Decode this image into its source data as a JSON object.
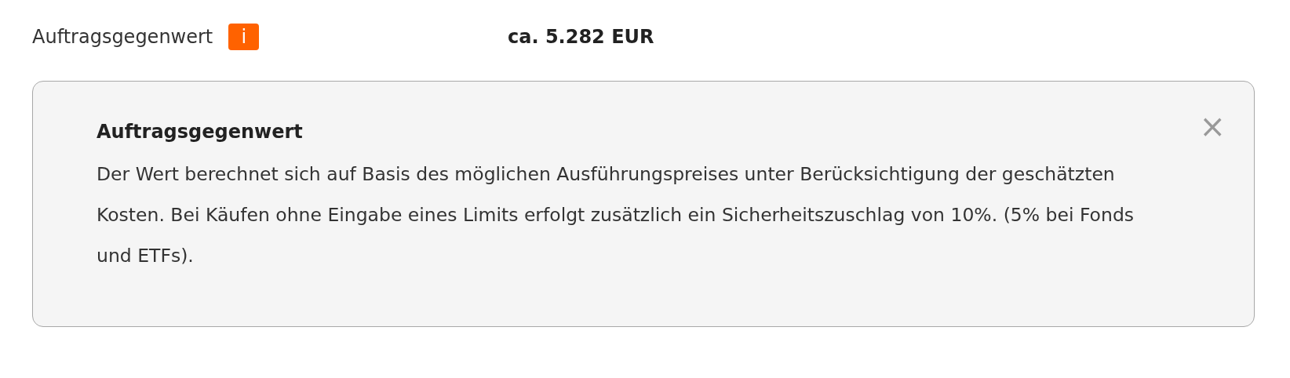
{
  "field": {
    "label": "Auftragsgegenwert",
    "info_button": "i",
    "value": "ca. 5.282 EUR"
  },
  "info_panel": {
    "title": "Auftragsgegenwert",
    "text": "Der Wert berechnet sich auf Basis des möglichen Ausführungspreises unter Berücksichtigung der geschätzten Kosten. Bei Käufen ohne Eingabe eines Limits erfolgt zusätzlich ein Sicherheitszuschlag von 10%. (5% bei Fonds und ETFs).",
    "close": "×"
  }
}
